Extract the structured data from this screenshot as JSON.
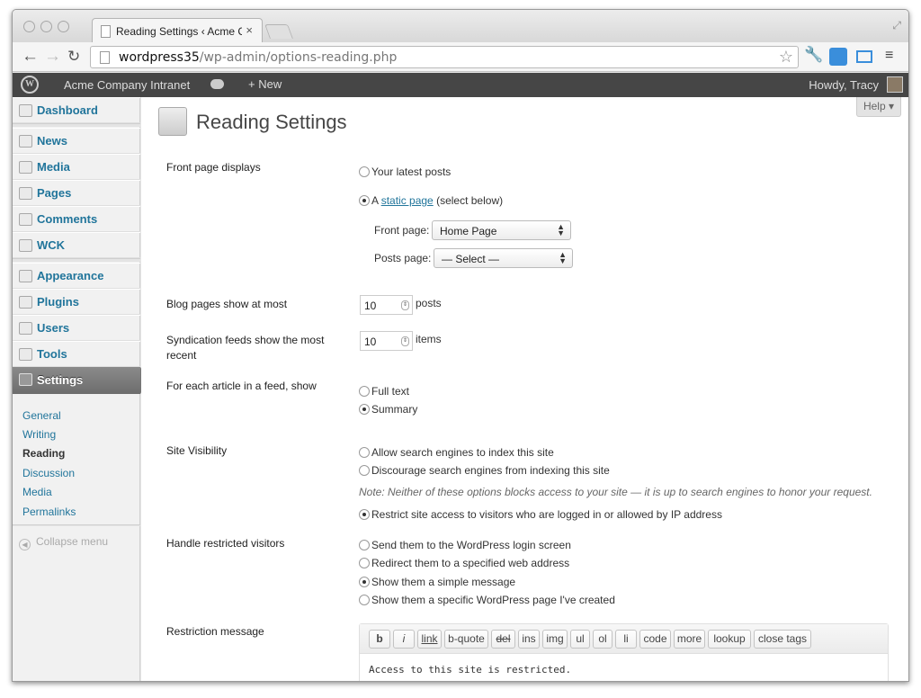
{
  "browser": {
    "tab_title": "Reading Settings ‹ Acme Co",
    "tab_close": "×",
    "url_host": "wordpress35",
    "url_path": "/wp-admin/options-reading.php"
  },
  "adminbar": {
    "site": "Acme Company Intranet",
    "new": "+ New",
    "howdy": "Howdy, Tracy"
  },
  "sidebar": {
    "items": [
      {
        "label": "Dashboard",
        "icon": "dashboard-icon"
      },
      {
        "label": "News",
        "icon": "pin-icon"
      },
      {
        "label": "Media",
        "icon": "media-icon"
      },
      {
        "label": "Pages",
        "icon": "pages-icon"
      },
      {
        "label": "Comments",
        "icon": "comment-icon"
      },
      {
        "label": "WCK",
        "icon": "gear-icon"
      },
      {
        "label": "Appearance",
        "icon": "appearance-icon"
      },
      {
        "label": "Plugins",
        "icon": "plugin-icon"
      },
      {
        "label": "Users",
        "icon": "users-icon"
      },
      {
        "label": "Tools",
        "icon": "tools-icon"
      },
      {
        "label": "Settings",
        "icon": "settings-icon"
      }
    ],
    "submenu": [
      "General",
      "Writing",
      "Reading",
      "Discussion",
      "Media",
      "Permalinks"
    ],
    "collapse": "Collapse menu"
  },
  "help": "Help ▾",
  "page_title": "Reading Settings",
  "front_page": {
    "label": "Front page displays",
    "opt_latest": "Your latest posts",
    "opt_static_a": "A",
    "opt_static_link": "static page",
    "opt_static_rest": "(select below)",
    "front_label": "Front page:",
    "front_value": "Home Page",
    "posts_label": "Posts page:",
    "posts_value": "— Select —"
  },
  "blog_pages": {
    "label": "Blog pages show at most",
    "value": "10",
    "unit": "posts"
  },
  "syndication": {
    "label": "Syndication feeds show the most recent",
    "value": "10",
    "unit": "items"
  },
  "feed_article": {
    "label": "For each article in a feed, show",
    "opt_full": "Full text",
    "opt_summary": "Summary"
  },
  "visibility": {
    "label": "Site Visibility",
    "opt_allow": "Allow search engines to index this site",
    "opt_discourage": "Discourage search engines from indexing this site",
    "note": "Note: Neither of these options blocks access to your site — it is up to search engines to honor your request.",
    "opt_restrict": "Restrict site access to visitors who are logged in or allowed by IP address"
  },
  "restricted": {
    "label": "Handle restricted visitors",
    "opt_login": "Send them to the WordPress login screen",
    "opt_redirect": "Redirect them to a specified web address",
    "opt_message": "Show them a simple message",
    "opt_page": "Show them a specific WordPress page I've created"
  },
  "restriction_message": {
    "label": "Restriction message",
    "buttons": [
      "b",
      "i",
      "link",
      "b-quote",
      "del",
      "ins",
      "img",
      "ul",
      "ol",
      "li",
      "code",
      "more",
      "lookup",
      "close tags"
    ],
    "text": "Access to this site is restricted."
  }
}
